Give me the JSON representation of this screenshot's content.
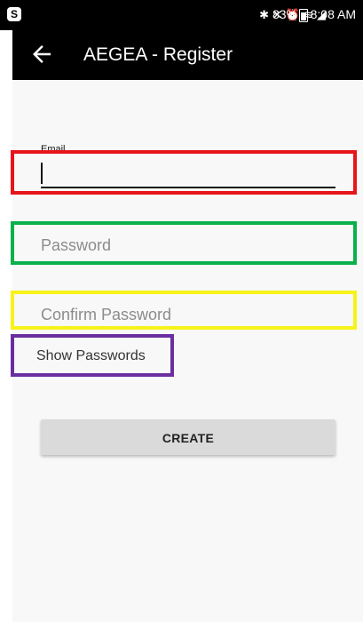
{
  "status_bar": {
    "app_icon_letter": "S",
    "battery_percent": "83%",
    "time": "8:08 AM",
    "icons": [
      "bluetooth-icon",
      "mute-icon",
      "alarm-icon",
      "wifi-icon",
      "signal-icon",
      "battery-icon"
    ]
  },
  "app_bar": {
    "title": "AEGEA - Register",
    "back_icon": "arrow-left-icon"
  },
  "form": {
    "email_label": "Email",
    "email_value": "",
    "password_placeholder": "Password",
    "confirm_placeholder": "Confirm Password",
    "show_passwords_label": "Show Passwords",
    "create_label": "CREATE"
  },
  "annotation_colors": {
    "email": "#e7151a",
    "password": "#0ab04a",
    "confirm_password": "#f7f319",
    "show_passwords": "#6a2ea0"
  }
}
